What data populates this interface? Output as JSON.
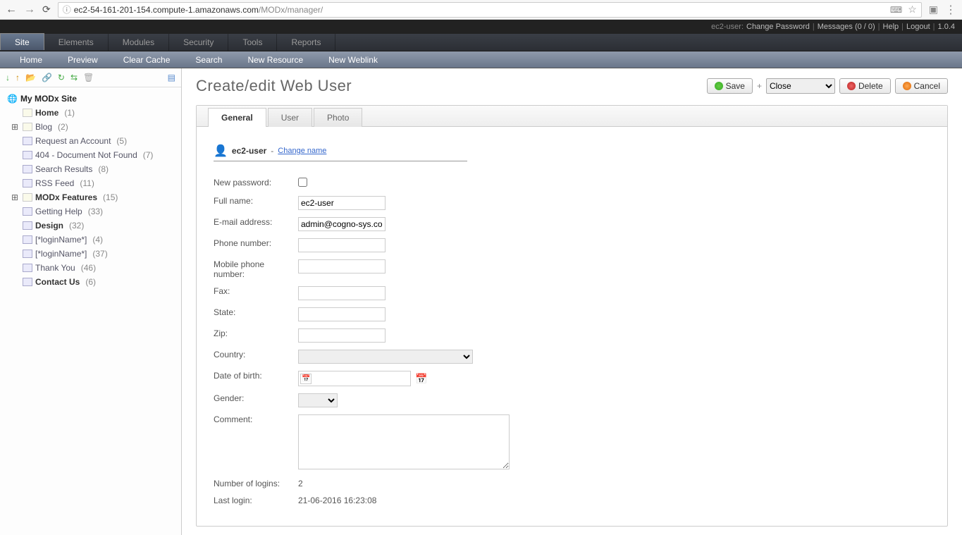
{
  "browser": {
    "url_host": "ec2-54-161-201-154.compute-1.amazonaws.com",
    "url_path": "/MODx/manager/"
  },
  "topbar": {
    "user_label": "ec2-user:",
    "change_pw": "Change Password",
    "messages": "Messages (0 / 0)",
    "help": "Help",
    "logout": "Logout",
    "version": "1.0.4"
  },
  "mainnav": [
    "Site",
    "Elements",
    "Modules",
    "Security",
    "Tools",
    "Reports"
  ],
  "subnav": [
    "Home",
    "Preview",
    "Clear Cache",
    "Search",
    "New Resource",
    "New Weblink"
  ],
  "tree": {
    "site_name": "My MODx Site",
    "items": [
      {
        "label": "Home",
        "count": "(1)",
        "bold": true,
        "type": "page",
        "expand": ""
      },
      {
        "label": "Blog",
        "count": "(2)",
        "bold": false,
        "type": "page",
        "expand": "+"
      },
      {
        "label": "Request an Account",
        "count": "(5)",
        "bold": false,
        "type": "code",
        "expand": ""
      },
      {
        "label": "404 - Document Not Found",
        "count": "(7)",
        "bold": false,
        "type": "code",
        "expand": ""
      },
      {
        "label": "Search Results",
        "count": "(8)",
        "bold": false,
        "type": "code",
        "expand": ""
      },
      {
        "label": "RSS Feed",
        "count": "(11)",
        "bold": false,
        "type": "code",
        "expand": ""
      },
      {
        "label": "MODx Features",
        "count": "(15)",
        "bold": true,
        "type": "page",
        "expand": "+"
      },
      {
        "label": "Getting Help",
        "count": "(33)",
        "bold": false,
        "type": "code",
        "expand": ""
      },
      {
        "label": "Design",
        "count": "(32)",
        "bold": true,
        "type": "code",
        "expand": ""
      },
      {
        "label": "[*loginName*]",
        "count": "(4)",
        "bold": false,
        "type": "code",
        "expand": ""
      },
      {
        "label": "[*loginName*]",
        "count": "(37)",
        "bold": false,
        "type": "code",
        "expand": ""
      },
      {
        "label": "Thank You",
        "count": "(46)",
        "bold": false,
        "type": "code",
        "expand": ""
      },
      {
        "label": "Contact Us",
        "count": "(6)",
        "bold": true,
        "type": "code",
        "expand": ""
      }
    ]
  },
  "page": {
    "title": "Create/edit Web User",
    "save": "Save",
    "close": "Close",
    "delete": "Delete",
    "cancel": "Cancel"
  },
  "tabs": [
    "General",
    "User",
    "Photo"
  ],
  "userhdr": {
    "name": "ec2-user",
    "change": "Change name"
  },
  "form": {
    "labels": {
      "newpw": "New password:",
      "fullname": "Full name:",
      "email": "E-mail address:",
      "phone": "Phone number:",
      "mobile": "Mobile phone number:",
      "fax": "Fax:",
      "state": "State:",
      "zip": "Zip:",
      "country": "Country:",
      "dob": "Date of birth:",
      "gender": "Gender:",
      "comment": "Comment:",
      "logins": "Number of logins:",
      "lastlogin": "Last login:"
    },
    "values": {
      "fullname": "ec2-user",
      "email": "admin@cogno-sys.com",
      "phone": "",
      "mobile": "",
      "fax": "",
      "state": "",
      "zip": "",
      "logins": "2",
      "lastlogin": "21-06-2016 16:23:08"
    }
  }
}
